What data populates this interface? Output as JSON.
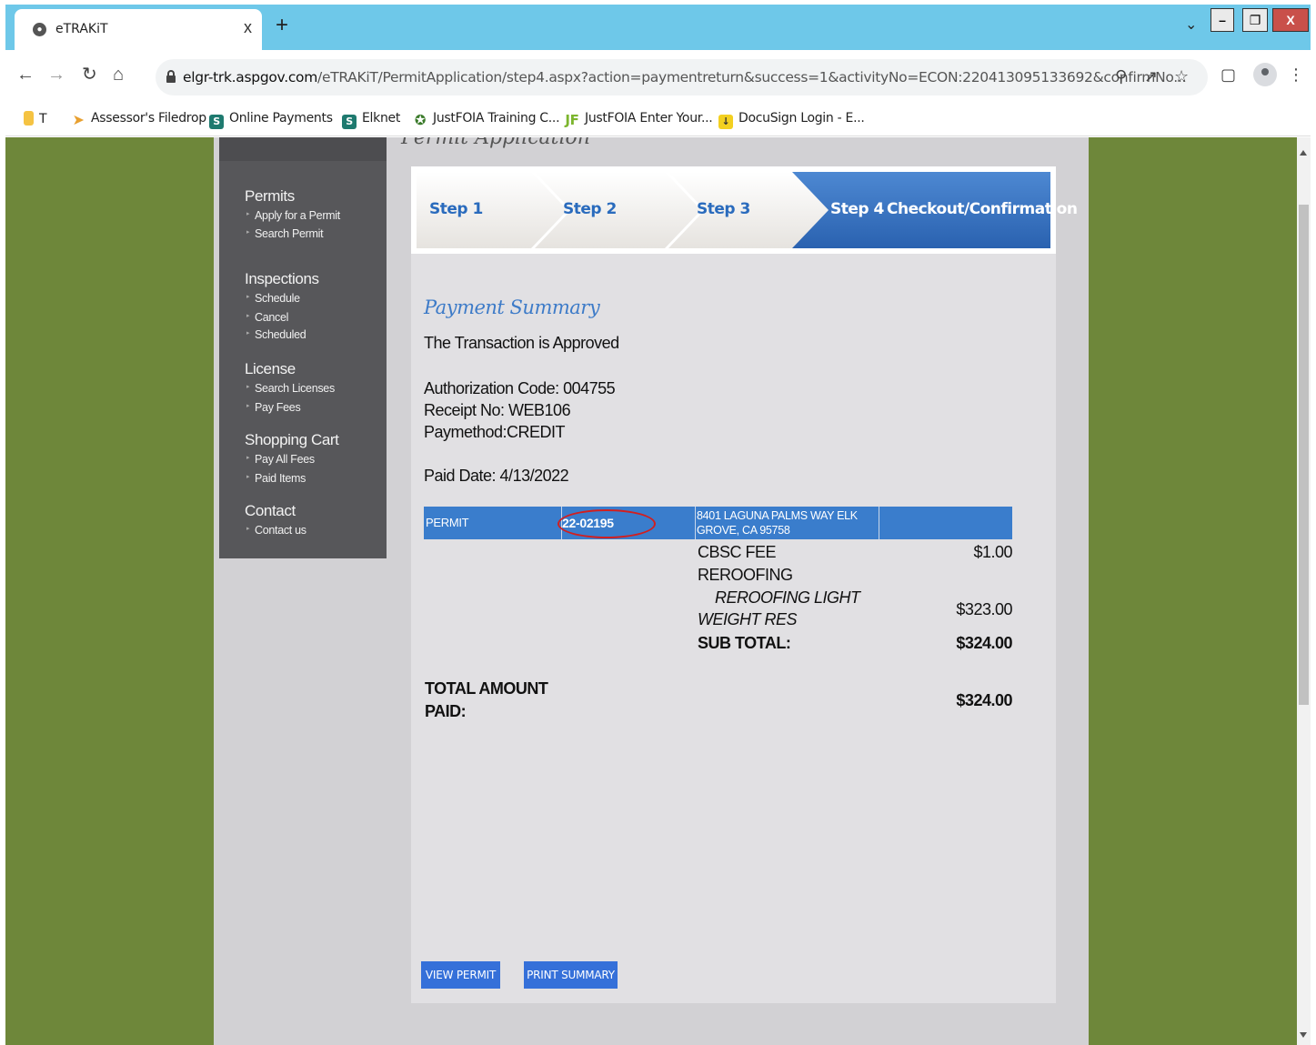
{
  "browser": {
    "tab_title": "eTRAKiT",
    "tab_close": "x",
    "new_tab": "+",
    "url_host": "elgr-trk.aspgov.com",
    "url_path": "/eTRAKiT/PermitApplication/step4.aspx?action=paymentreturn&success=1&activityNo=ECON:220413095133692&confirmNo...",
    "bookmarks": [
      "T",
      "Assessor's Filedrop",
      "Online Payments",
      "Elknet",
      "JustFOIA Training C...",
      "JustFOIA Enter Your...",
      "DocuSign Login - E..."
    ]
  },
  "page": {
    "heading_partial": "Permit Application",
    "sidebar": {
      "sections": [
        {
          "title": "Permits",
          "items": [
            "Apply for a Permit",
            "Search Permit"
          ]
        },
        {
          "title": "Inspections",
          "items": [
            "Schedule",
            "Cancel",
            "Scheduled"
          ]
        },
        {
          "title": "License",
          "items": [
            "Search Licenses",
            "Pay Fees"
          ]
        },
        {
          "title": "Shopping Cart",
          "items": [
            "Pay All Fees",
            "Paid Items"
          ]
        },
        {
          "title": "Contact",
          "items": [
            "Contact us"
          ]
        }
      ]
    },
    "steps": [
      "Step 1",
      "Step 2",
      "Step 3",
      "Step 4",
      "Checkout/Confirmation"
    ],
    "summary": {
      "title": "Payment Summary",
      "status": "The Transaction is Approved",
      "auth_code": "Authorization Code: 004755",
      "receipt": "Receipt No: WEB106",
      "paymethod": "Paymethod:CREDIT",
      "paid_date": "Paid Date: 4/13/2022"
    },
    "permit_row": {
      "type": "PERMIT",
      "number": "22-02195",
      "address_line1": "8401 LAGUNA PALMS WAY ELK",
      "address_line2": "GROVE, CA 95758"
    },
    "fees": {
      "cbsc_label": "CBSC FEE",
      "cbsc_amount": "$1.00",
      "reroofing_label": "REROOFING",
      "reroofing_sub1": "REROOFING LIGHT",
      "reroofing_sub2": "WEIGHT RES",
      "reroofing_amount": "$323.00",
      "subtotal_label": "SUB TOTAL:",
      "subtotal_amount": "$324.00",
      "total_label_1": "TOTAL AMOUNT",
      "total_label_2": "PAID:",
      "total_amount": "$324.00"
    },
    "buttons": {
      "view_permit": "VIEW PERMIT",
      "print_summary": "PRINT SUMMARY"
    }
  },
  "colors": {
    "accent": "#3a7dcc",
    "page_bg": "#6e873a",
    "sidebar": "#57575a"
  }
}
